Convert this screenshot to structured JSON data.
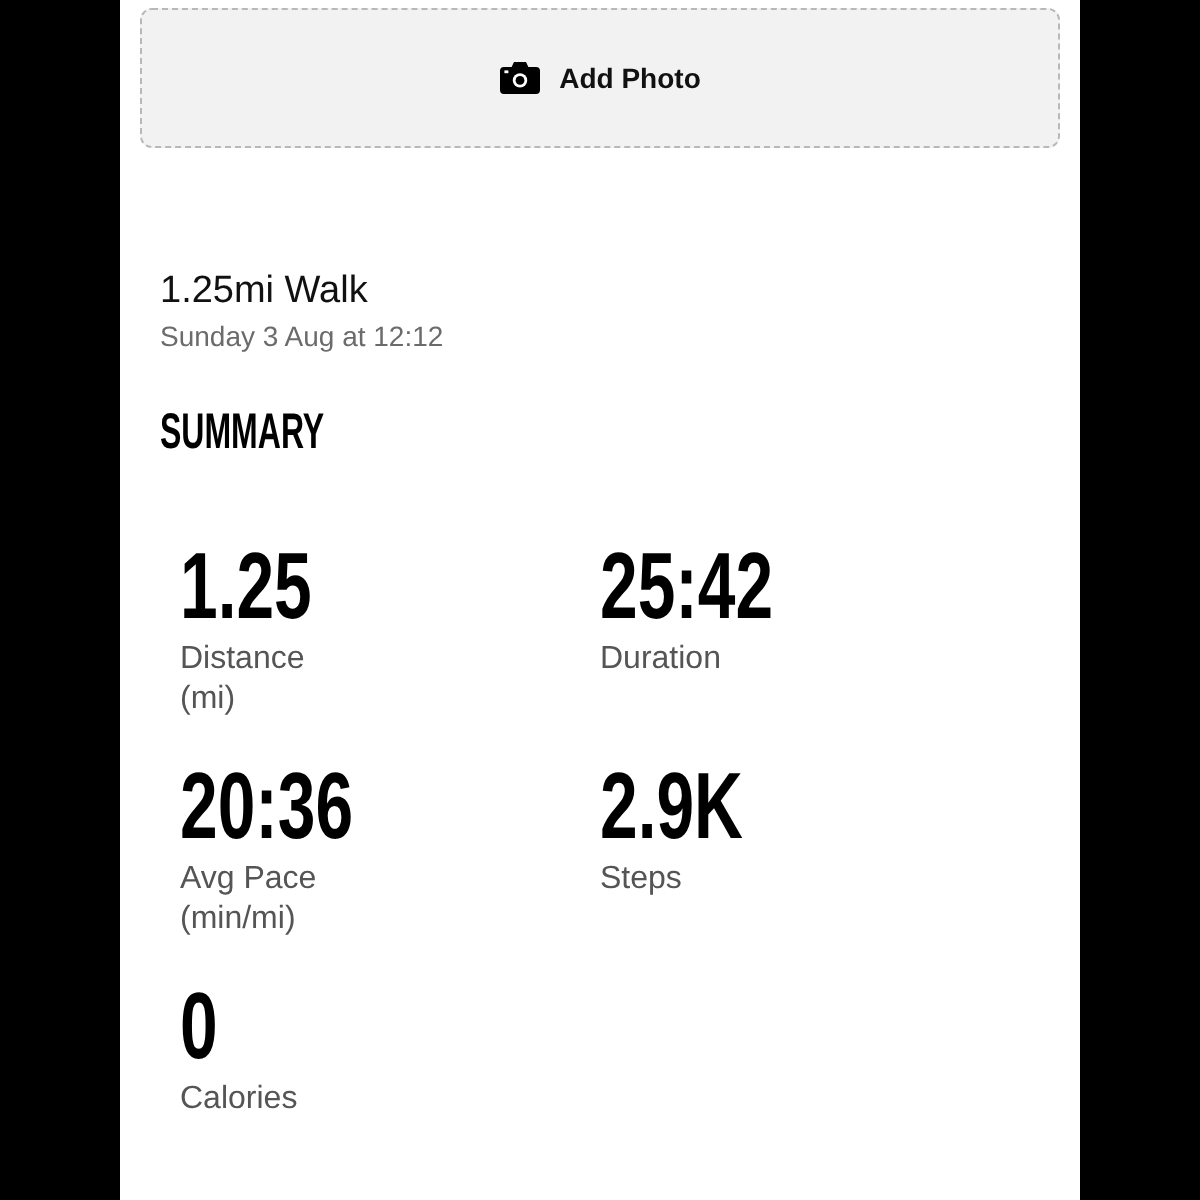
{
  "add_photo": {
    "label": "Add Photo"
  },
  "activity": {
    "title": "1.25mi Walk",
    "date": "Sunday 3 Aug at 12:12"
  },
  "summary": {
    "heading": "SUMMARY",
    "stats": [
      {
        "value": "1.25",
        "label": "Distance (mi)"
      },
      {
        "value": "25:42",
        "label": "Duration"
      },
      {
        "value": "20:36",
        "label": "Avg Pace (min/mi)"
      },
      {
        "value": "2.9K",
        "label": "Steps"
      },
      {
        "value": "0",
        "label": "Calories"
      }
    ]
  }
}
